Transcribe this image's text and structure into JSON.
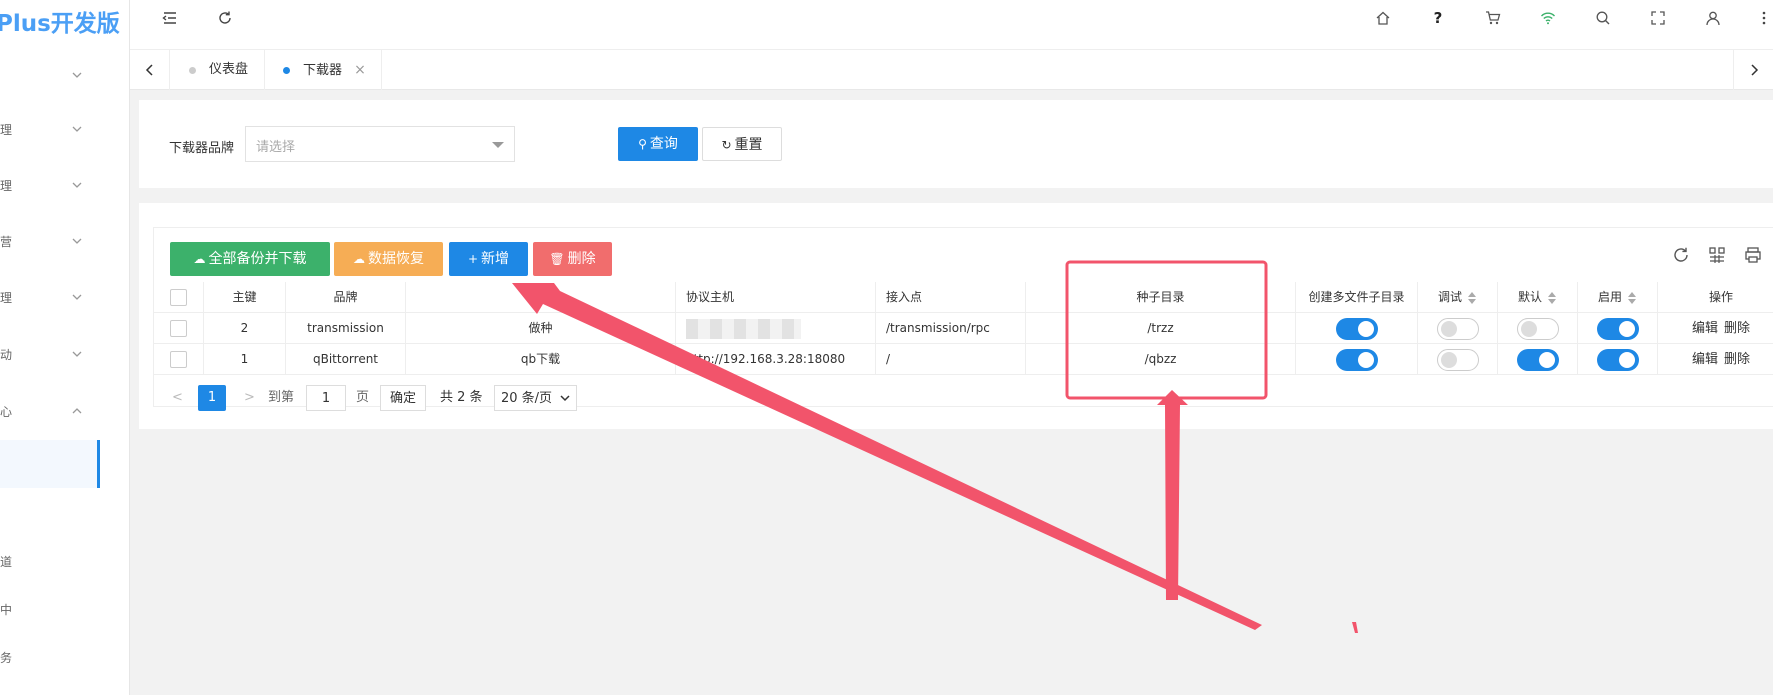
{
  "app": {
    "logo_text": "Plus开发版"
  },
  "sidebar": {
    "items": [
      {
        "label": ""
      },
      {
        "label": "理"
      },
      {
        "label": "理"
      },
      {
        "label": "营"
      },
      {
        "label": "理"
      },
      {
        "label": "动"
      },
      {
        "label": "心"
      },
      {
        "label": ""
      },
      {
        "label": "道"
      },
      {
        "label": "中"
      },
      {
        "label": "务"
      }
    ]
  },
  "header": {
    "icons": [
      "menu-fold-icon",
      "refresh-icon",
      "home-icon",
      "help-icon",
      "cart-icon",
      "wifi-icon",
      "search-icon",
      "fullscreen-icon",
      "user-icon",
      "more-icon"
    ],
    "help_glyph": "?"
  },
  "tabs": {
    "items": [
      {
        "label": "仪表盘",
        "dot_color": "#cccccc"
      },
      {
        "label": "下载器",
        "dot_color": "#1e88e5",
        "close": "×"
      }
    ]
  },
  "search": {
    "brand_label": "下载器品牌",
    "brand_placeholder": "请选择",
    "query_button": "查询",
    "reset_button": "重置"
  },
  "toolbar": {
    "backup_button": "全部备份并下载",
    "restore_button": "数据恢复",
    "add_button": "新增",
    "delete_button": "删除"
  },
  "table": {
    "columns": [
      "主键",
      "品牌",
      "",
      "协议主机",
      "接入点",
      "种子目录",
      "创建多文件子目录",
      "调试",
      "默认",
      "启用",
      "操作"
    ],
    "rows": [
      {
        "id": "2",
        "brand": "transmission",
        "name": "做种",
        "host": "",
        "endpoint": "/transmission/rpc",
        "seed_dir": "/trzz",
        "multi_dir": true,
        "debug": false,
        "default": false,
        "enabled": true,
        "edit": "编辑",
        "delete": "删除"
      },
      {
        "id": "1",
        "brand": "qBittorrent",
        "name": "qb下载",
        "host": "http://192.168.3.28:18080",
        "endpoint": "/",
        "seed_dir": "/qbzz",
        "multi_dir": true,
        "debug": false,
        "default": true,
        "enabled": true,
        "edit": "编辑",
        "delete": "删除"
      }
    ]
  },
  "pagination": {
    "prev": "<",
    "current": "1",
    "next": ">",
    "goto_label": "到第",
    "goto_value": "1",
    "page_unit": "页",
    "confirm": "确定",
    "total": "共 2 条",
    "page_size": "20 条/页"
  },
  "colors": {
    "primary": "#1e88e5",
    "success": "#3cb16b",
    "warning": "#f6ad55",
    "danger": "#f16d6d",
    "annotation": "#f2546b"
  }
}
